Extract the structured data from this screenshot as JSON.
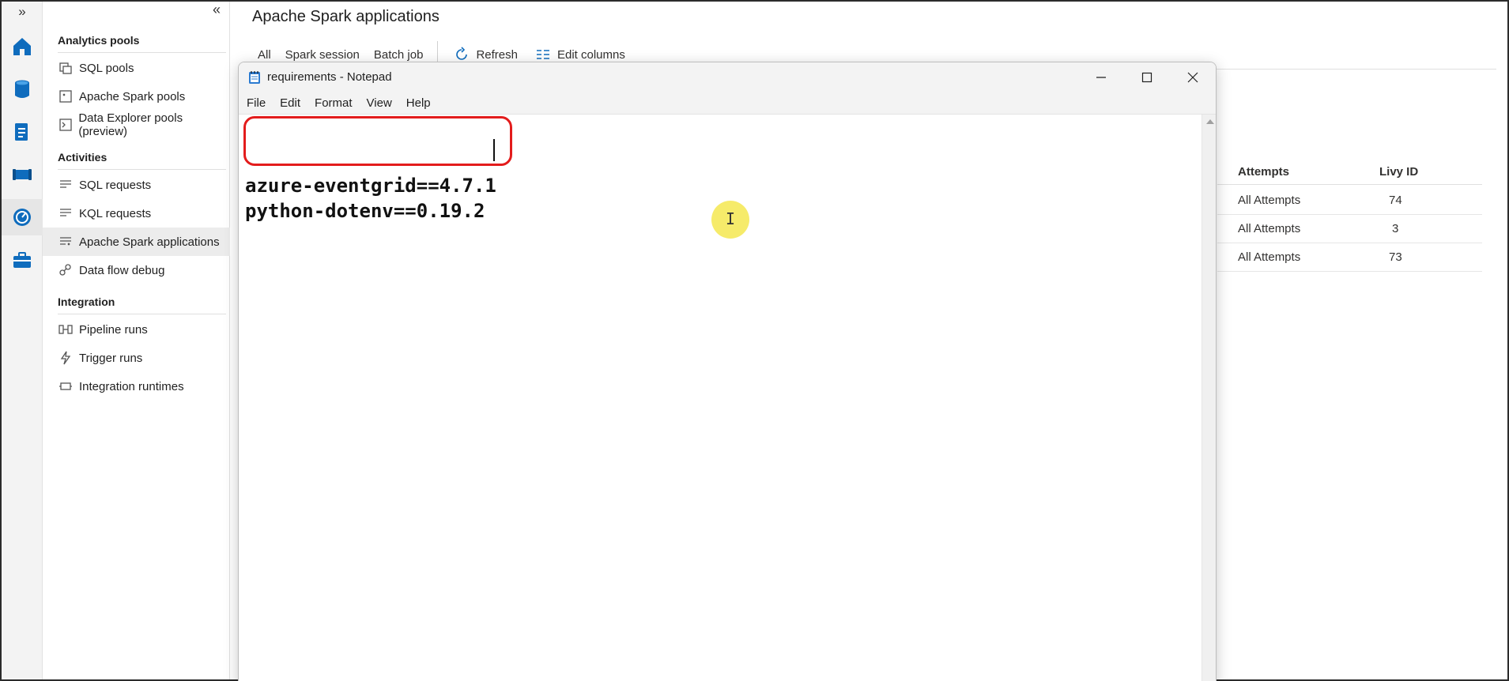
{
  "rail": {
    "expand_label": "»",
    "items": [
      {
        "icon": "home-icon",
        "color": "#0f6cbd"
      },
      {
        "icon": "database-icon",
        "color": "#0f6cbd"
      },
      {
        "icon": "document-icon",
        "color": "#0f6cbd"
      },
      {
        "icon": "pipeline-icon",
        "color": "#0f6cbd"
      },
      {
        "icon": "monitor-icon",
        "color": "#0f6cbd",
        "active": true
      },
      {
        "icon": "toolbox-icon",
        "color": "#0f6cbd"
      }
    ]
  },
  "nav": {
    "collapse_label": "«",
    "sections": [
      {
        "label": "Analytics pools",
        "items": [
          {
            "label": "SQL pools",
            "icon": "sql-pool-icon"
          },
          {
            "label": "Apache Spark pools",
            "icon": "spark-pool-icon"
          },
          {
            "label": "Data Explorer pools (preview)",
            "icon": "data-explorer-icon"
          }
        ]
      },
      {
        "label": "Activities",
        "items": [
          {
            "label": "SQL requests",
            "icon": "sql-requests-icon"
          },
          {
            "label": "KQL requests",
            "icon": "kql-requests-icon"
          },
          {
            "label": "Apache Spark applications",
            "icon": "spark-applications-icon",
            "selected": true
          },
          {
            "label": "Data flow debug",
            "icon": "data-flow-icon"
          }
        ]
      },
      {
        "label": "Integration",
        "items": [
          {
            "label": "Pipeline runs",
            "icon": "pipeline-runs-icon"
          },
          {
            "label": "Trigger runs",
            "icon": "trigger-icon"
          },
          {
            "label": "Integration runtimes",
            "icon": "runtime-icon"
          }
        ]
      }
    ]
  },
  "main": {
    "title": "Apache Spark applications",
    "tabs": [
      "All",
      "Spark session",
      "Batch job"
    ],
    "refresh_label": "Refresh",
    "edit_columns_label": "Edit columns",
    "table": {
      "columns": [
        "Attempts",
        "Livy ID"
      ],
      "rows": [
        [
          "All Attempts",
          "74"
        ],
        [
          "All Attempts",
          "3"
        ],
        [
          "All Attempts",
          "73"
        ]
      ]
    }
  },
  "notepad": {
    "title": "requirements - Notepad",
    "menu": [
      "File",
      "Edit",
      "Format",
      "View",
      "Help"
    ],
    "lines": [
      "azure-eventgrid==4.7.1",
      "python-dotenv==0.19.2"
    ],
    "highlight_color": "#e31c1c"
  },
  "cursor": {
    "symbol": "I",
    "highlight_color": "#f5e750"
  }
}
